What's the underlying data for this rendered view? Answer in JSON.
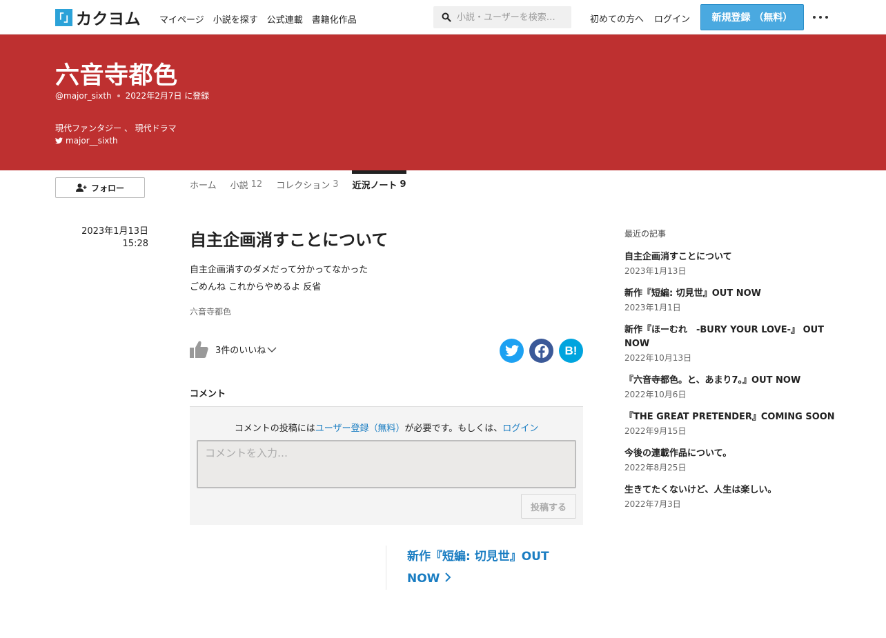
{
  "header": {
    "logo_mark": "「」",
    "logo_text": "カクヨム",
    "nav": [
      "マイページ",
      "小説を探す",
      "公式連載",
      "書籍化作品"
    ],
    "search_placeholder": "小説・ユーザーを検索…",
    "beginner_link": "初めての方へ",
    "login_link": "ログイン",
    "signup_button": "新規登録 （無料）"
  },
  "profile": {
    "name": "六音寺都色",
    "handle": "@major_sixth",
    "registered": "2022年2月7日 に登録",
    "genres": "現代ファンタジー 、 現代ドラマ",
    "twitter": "major__sixth"
  },
  "follow_button": "フォロー",
  "tabs": [
    {
      "label": "ホーム",
      "count": ""
    },
    {
      "label": "小説",
      "count": "12"
    },
    {
      "label": "コレクション",
      "count": "3"
    },
    {
      "label": "近況ノート",
      "count": "9"
    }
  ],
  "post": {
    "date": "2023年1月13日",
    "time": "15:28",
    "title": "自主企画消すことについて",
    "body_line1": "自主企画消すのダメだって分かってなかった",
    "body_line2": "ごめんね これからやめるよ 反省",
    "author": "六音寺都色",
    "likes": "3件のいいね"
  },
  "share_icons": [
    "twitter-icon",
    "facebook-icon",
    "hatena-bookmark-icon"
  ],
  "hatena_label": "B!",
  "comments": {
    "heading": "コメント",
    "note_prefix": "コメントの投稿には",
    "note_signup_link": "ユーザー登録（無料）",
    "note_middle": "が必要です。もしくは、",
    "note_login_link": "ログイン",
    "input_placeholder": "コメントを入力…",
    "submit_label": "投稿する"
  },
  "next_post": "新作『短編: 切見世』OUT NOW",
  "sidebar": {
    "heading": "最近の記事",
    "items": [
      {
        "title": "自主企画消すことについて",
        "date": "2023年1月13日"
      },
      {
        "title": "新作『短編: 切見世』OUT NOW",
        "date": "2023年1月1日"
      },
      {
        "title": "新作『ほーむれ　-BURY YOUR LOVE-』 OUT NOW",
        "date": "2022年10月13日"
      },
      {
        "title": "『六音寺都色。と、あまり7。』OUT NOW",
        "date": "2022年10月6日"
      },
      {
        "title": "『THE GREAT PRETENDER』COMING SOON",
        "date": "2022年9月15日"
      },
      {
        "title": "今後の連載作品について。",
        "date": "2022年8月25日"
      },
      {
        "title": "生きてたくないけど、人生は楽しい。",
        "date": "2022年7月3日"
      }
    ]
  },
  "colors": {
    "banner": "#be3030",
    "accent_blue": "#4aa9e0",
    "link": "#1a7dc2",
    "twitter": "#1da1f2",
    "facebook": "#3b5998",
    "hatena": "#00a4de"
  }
}
